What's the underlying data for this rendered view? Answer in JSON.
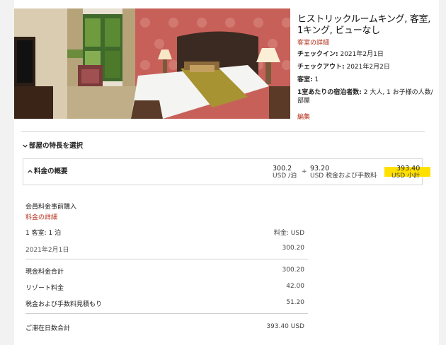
{
  "room": {
    "title": "ヒストリックルームキング, 客室, 1キング, ビューなし",
    "details_link": "客室の詳細",
    "checkin_label": "チェックイン:",
    "checkin_value": "2021年2月1日",
    "checkout_label": "チェックアウト:",
    "checkout_value": "2021年2月2日",
    "rooms_label": "客室:",
    "rooms_value": "1",
    "guests_label": "1室あたりの宿泊者数:",
    "guests_value": "2 大人, 1 お子様の人数/部屋",
    "edit_link": "編集"
  },
  "features": {
    "toggle_label": "部屋の特長を選択"
  },
  "summary": {
    "label": "料金の概要",
    "nightly_value": "300.2",
    "nightly_sub": "USD /泊",
    "plus": "+",
    "tax_value": "93.20",
    "tax_sub": "USD 税金および手数料",
    "subtotal_value": "393.40",
    "subtotal_sub": "USD 小計",
    "highlight_color": "#ffe000"
  },
  "breakdown": {
    "member_label": "会員料金事前購入",
    "rate_details_link": "料金の詳細",
    "room_nights": "1 客室: 1 泊",
    "rate_currency": "料金: USD",
    "date": "2021年2月1日",
    "date_amount": "300.20",
    "cash_total_label": "現金料金合計",
    "cash_total_value": "300.20",
    "resort_fee_label": "リゾート料金",
    "resort_fee_value": "42.00",
    "tax_estimate_label": "税金および手数料見積もり",
    "tax_estimate_value": "51.20",
    "stay_total_label": "ご滞在日数合計",
    "stay_total_value": "393.40 USD"
  }
}
